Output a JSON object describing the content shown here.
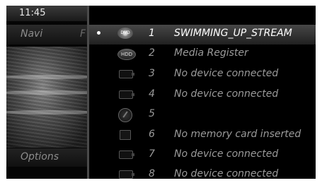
{
  "status": {
    "time": "11:45"
  },
  "left_menu": {
    "navi_label": "Navi",
    "navi_cut_label": "F",
    "options_label": "Options"
  },
  "list": {
    "items": [
      {
        "number": "1",
        "label": "SWIMMING_UP_STREAM",
        "icon": "disc-icon",
        "icon_text": "DVD",
        "selected": true
      },
      {
        "number": "2",
        "label": "Media Register",
        "icon": "hdd-icon",
        "icon_text": "HDD",
        "selected": false
      },
      {
        "number": "3",
        "label": "No device connected",
        "icon": "usb-icon",
        "icon_text": "",
        "selected": false
      },
      {
        "number": "4",
        "label": "No device connected",
        "icon": "usb-icon",
        "icon_text": "",
        "selected": false
      },
      {
        "number": "5",
        "label": "",
        "icon": "radio-icon",
        "icon_text": "",
        "selected": false
      },
      {
        "number": "6",
        "label": "No memory card inserted",
        "icon": "memory-card-icon",
        "icon_text": "",
        "selected": false
      },
      {
        "number": "7",
        "label": "No device connected",
        "icon": "usb-icon",
        "icon_text": "",
        "selected": false
      },
      {
        "number": "8",
        "label": "No device connected",
        "icon": "usb-icon",
        "icon_text": "",
        "selected": false
      }
    ]
  },
  "colors": {
    "background": "#000000",
    "text_selected": "#ffffff",
    "text_normal": "#9a9a9a"
  }
}
